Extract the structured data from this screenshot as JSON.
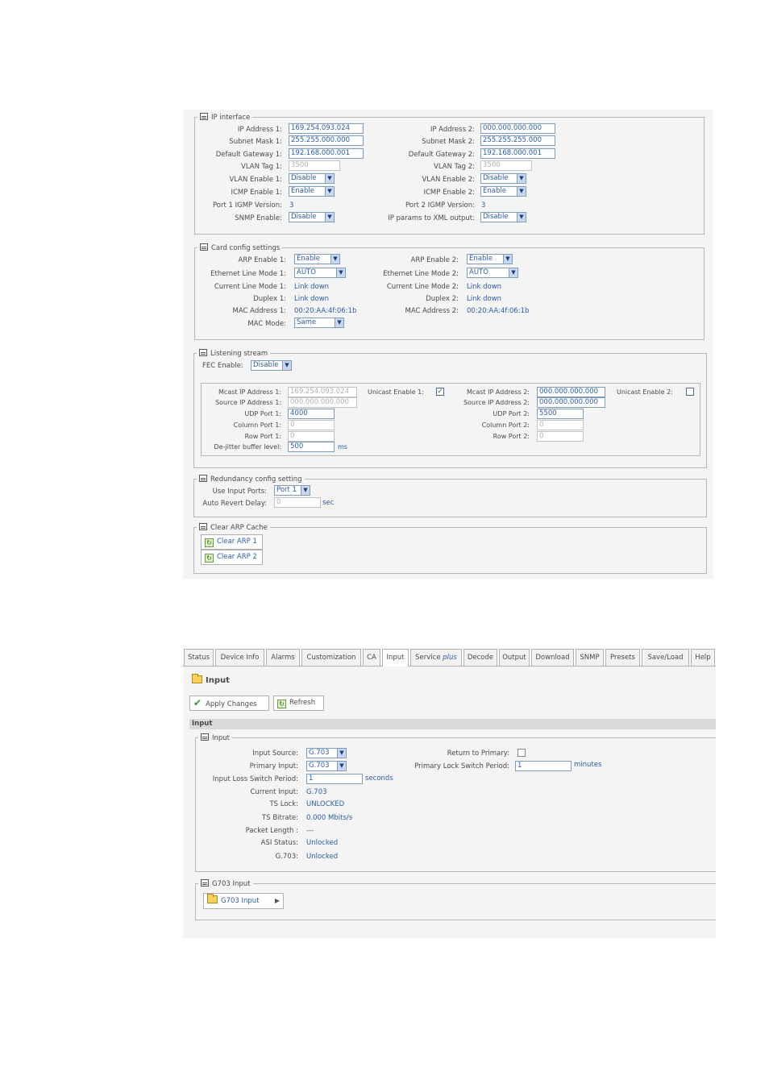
{
  "top": {
    "ip": {
      "legend": "IP interface",
      "rows": [
        {
          "l1": "IP Address 1:",
          "v1": "169.254.093.024",
          "l2": "IP Address 2:",
          "v2": "000.000.000.000"
        },
        {
          "l1": "Subnet Mask 1:",
          "v1": "255.255.000.000",
          "l2": "Subnet Mask 2:",
          "v2": "255.255.255.000"
        },
        {
          "l1": "Default Gateway 1:",
          "v1": "192.168.000.001",
          "l2": "Default Gateway 2:",
          "v2": "192.168.000.001"
        },
        {
          "l1": "VLAN Tag 1:",
          "v1": "3500",
          "l2": "VLAN Tag 2:",
          "v2": "3500"
        },
        {
          "l1": "VLAN Enable 1:",
          "v1": "Disable",
          "l2": "VLAN Enable 2:",
          "v2": "Disable"
        },
        {
          "l1": "ICMP Enable 1:",
          "v1": "Enable",
          "l2": "ICMP Enable 2:",
          "v2": "Enable"
        },
        {
          "l1": "Port 1 IGMP Version:",
          "v1": "3",
          "l2": "Port 2 IGMP Version:",
          "v2": "3"
        },
        {
          "l1": "SNMP Enable:",
          "v1": "Disable",
          "l2": "IP params to XML output:",
          "v2": "Disable"
        }
      ]
    },
    "card": {
      "legend": "Card config settings",
      "rows": [
        {
          "l1": "ARP Enable 1:",
          "v1": "Enable",
          "l2": "ARP Enable 2:",
          "v2": "Enable"
        },
        {
          "l1": "Ethernet Line Mode 1:",
          "v1": "AUTO",
          "l2": "Ethernet Line Mode 2:",
          "v2": "AUTO"
        },
        {
          "l1": "Current Line Mode 1:",
          "v1": "Link down",
          "l2": "Current Line Mode 2:",
          "v2": "Link down"
        },
        {
          "l1": "Duplex 1:",
          "v1": "Link down",
          "l2": "Duplex 2:",
          "v2": "Link down"
        },
        {
          "l1": "MAC Address 1:",
          "v1": "00:20:AA:4f:06:1b",
          "l2": "MAC Address 2:",
          "v2": "00:20:AA:4f:06:1b"
        },
        {
          "l1": "MAC Mode:",
          "v1": "Same"
        }
      ]
    },
    "listen": {
      "legend": "Listening stream",
      "fec_label": "FEC Enable:",
      "fec_value": "Disable",
      "rows1": [
        {
          "l": "Mcast IP Address 1:",
          "v": "169.254.093.024"
        },
        {
          "l": "Source IP Address 1:",
          "v": "000.000.000.000"
        },
        {
          "l": "UDP Port 1:",
          "v": "4000"
        },
        {
          "l": "Column Port 1:",
          "v": "0"
        },
        {
          "l": "Row Port 1:",
          "v": "0"
        },
        {
          "l": "De-jitter buffer level:",
          "v": "500"
        }
      ],
      "ms": "ms",
      "unicast1_label": "Unicast Enable 1:",
      "unicast1_checked": true,
      "rows2": [
        {
          "l": "Mcast IP Address 2:",
          "v": "000.000.000.000"
        },
        {
          "l": "Source IP Address 2:",
          "v": "000.000.000.000"
        },
        {
          "l": "UDP Port 2:",
          "v": "5500"
        },
        {
          "l": "Column Port 2:",
          "v": "0"
        },
        {
          "l": "Row Port 2:",
          "v": "0"
        }
      ],
      "unicast2_label": "Unicast Enable 2:",
      "unicast2_checked": false
    },
    "redund": {
      "legend": "Redundancy config setting",
      "ports_label": "Use Input Ports:",
      "ports_value": "Port 1",
      "delay_label": "Auto Revert Delay:",
      "delay_value": "0",
      "sec": "sec"
    },
    "arp": {
      "legend": "Clear ARP Cache",
      "btn1": "Clear ARP 1",
      "btn2": "Clear ARP 2"
    }
  },
  "bottom": {
    "tabs": [
      "Status",
      "Device Info",
      "Alarms",
      "Customization",
      "CA",
      "Input",
      "Service",
      "Decode",
      "Output",
      "Download",
      "SNMP",
      "Presets",
      "Save/Load",
      "Help"
    ],
    "service_suffix": "plus",
    "active_tab": "Input",
    "page_title": "Input",
    "apply_label": "Apply Changes",
    "refresh_label": "Refresh",
    "section_header": "Input",
    "input_legend": "Input",
    "input_source_label": "Input Source:",
    "input_source": "G.703",
    "primary_input_label": "Primary Input:",
    "primary_input": "G.703",
    "loss_label": "Input Loss Switch Period:",
    "loss_value": "1",
    "seconds": "seconds",
    "return_label": "Return to Primary:",
    "lock_label": "Primary Lock Switch Period:",
    "lock_value": "1",
    "minutes": "minutes",
    "status_rows": [
      {
        "l": "Current Input:",
        "v": "G.703"
      },
      {
        "l": "TS Lock:",
        "v": "UNLOCKED"
      },
      {
        "l": "TS Bitrate:",
        "v": "0.000 Mbits/s"
      },
      {
        "l": "Packet Length :",
        "v": "---"
      },
      {
        "l": "ASI Status:",
        "v": "Unlocked"
      },
      {
        "l": "G.703:",
        "v": "Unlocked"
      }
    ],
    "g703_legend": "G703 Input",
    "g703_button": "G703 Input"
  },
  "colors": {
    "value_blue": "#2d5ca8",
    "panel_bg": "#f4f4f4",
    "border": "#b7b7b7"
  }
}
